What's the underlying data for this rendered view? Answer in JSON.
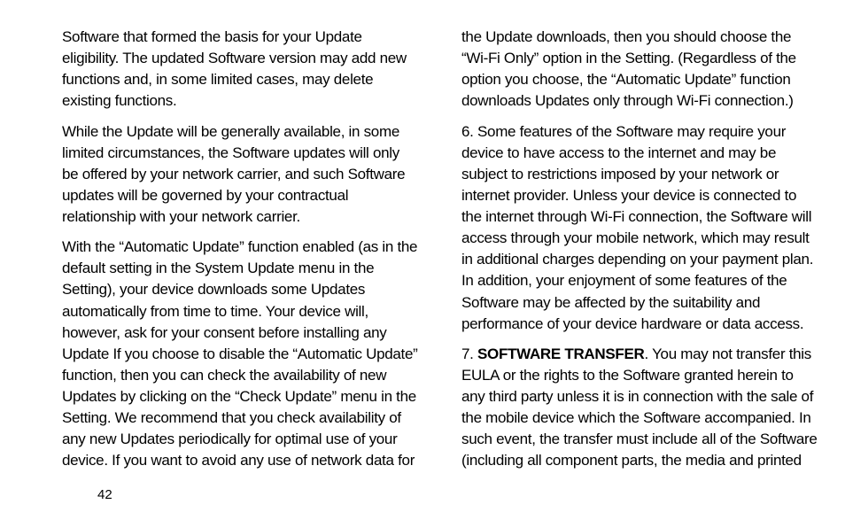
{
  "leftColumn": {
    "p1": "Software that formed the basis for your Update eligibility. The updated Software version may add new functions and, in some limited cases, may delete existing functions.",
    "p2": "While the Update will be generally available, in some limited circumstances, the Software updates will only be offered by your network carrier, and such Software updates will be governed by your contractual relationship with your network carrier.",
    "p3": "With the “Automatic Update” function enabled (as in the default setting in the System Update menu in the Setting), your device downloads some Updates automatically from time to time. Your device will, however, ask for your consent before installing any Update If you choose to disable the “Automatic Update” function, then you can check the availability of new Updates by clicking on the “Check Update” menu in the Setting. We recommend that you check availability of any new Updates periodically for optimal use of your device. If you want to avoid any use of network data for"
  },
  "rightColumn": {
    "p1": "the Update downloads, then you should choose the “Wi-Fi Only” option in the Setting. (Regardless of the option you choose, the “Automatic Update” function downloads Updates only through Wi-Fi connection.)",
    "p2": "6. Some features of the Software may require your device to have access to the internet and may be subject to restrictions imposed by your network or internet provider. Unless your device is connected to the internet through Wi-Fi connection, the Software will access through your mobile network, which may result in additional charges depending on your payment plan. In addition, your enjoyment of some features of the Software may be affected by the suitability and performance of your device hardware or data access.",
    "p3_prefix": "7. ",
    "p3_label": "SOFTWARE TRANSFER",
    "p3_rest": ". You may not transfer this EULA or the rights to the Software granted herein to any third party unless it is in connection with the sale of the mobile device which the Software accompanied. In such event, the transfer must include all of the Software (including all component parts, the media and printed"
  },
  "pageNumber": "42"
}
